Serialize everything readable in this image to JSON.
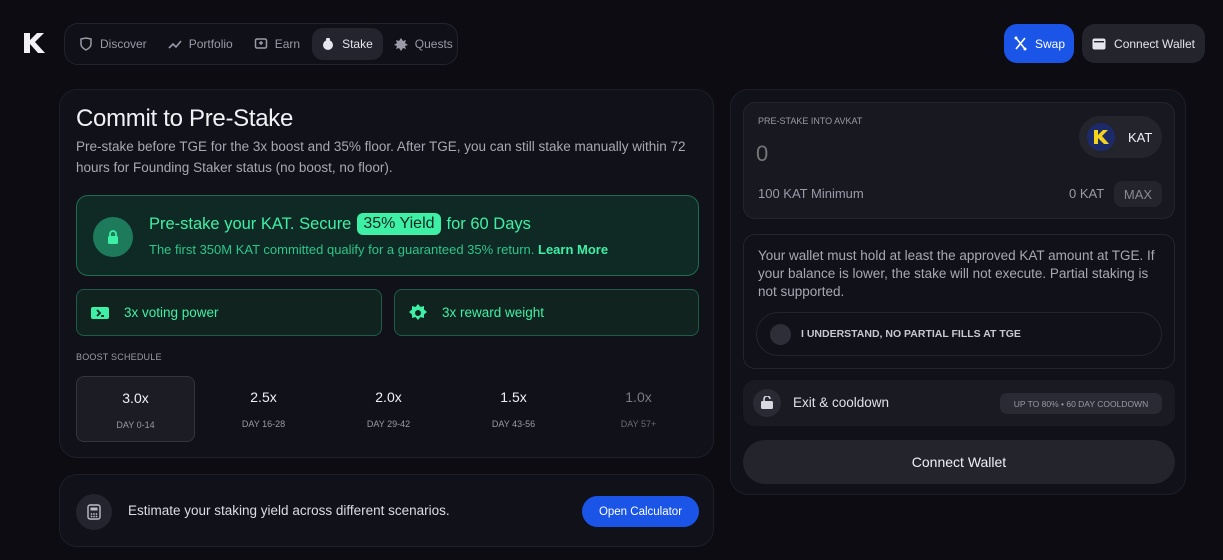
{
  "header": {
    "nav": [
      {
        "label": "Discover",
        "icon": "shield-icon"
      },
      {
        "label": "Portfolio",
        "icon": "trend-icon"
      },
      {
        "label": "Earn",
        "icon": "earn-icon"
      },
      {
        "label": "Stake",
        "icon": "stake-icon",
        "active": true
      },
      {
        "label": "Quests",
        "icon": "quests-icon"
      }
    ],
    "swap_label": "Swap",
    "connect_label": "Connect Wallet"
  },
  "main": {
    "title": "Commit to Pre-Stake",
    "description": "Pre-stake before TGE for the 3x boost and 35% floor. After TGE, you can still stake manually within 72 hours for Founding Staker status (no boost, no floor).",
    "promo": {
      "headline_pre": "Pre-stake your KAT. Secure",
      "headline_pill": "35% Yield",
      "headline_post": "for 60 Days",
      "subtext": "The first 350M KAT committed qualify for a guaranteed 35% return.",
      "link": "Learn More"
    },
    "perks": [
      "3x voting power",
      "3x reward weight"
    ],
    "boost_label": "BOOST SCHEDULE",
    "boost_schedule": [
      {
        "mult": "3.0x",
        "days": "DAY 0-14"
      },
      {
        "mult": "2.5x",
        "days": "DAY 16-28"
      },
      {
        "mult": "2.0x",
        "days": "DAY 29-42"
      },
      {
        "mult": "1.5x",
        "days": "DAY 43-56"
      },
      {
        "mult": "1.0x",
        "days": "DAY 57+"
      }
    ]
  },
  "calculator": {
    "text": "Estimate your staking yield across different scenarios.",
    "button": "Open Calculator"
  },
  "stake_panel": {
    "input_label": "PRE-STAKE INTO AVKAT",
    "amount_placeholder": "0",
    "token": "KAT",
    "minimum": "100 KAT Minimum",
    "balance": "0 KAT",
    "max_label": "MAX",
    "warning": "Your wallet must hold at least the approved KAT amount at TGE. If your balance is lower, the stake will not execute. Partial staking is not supported.",
    "acknowledge": "I UNDERSTAND, NO PARTIAL FILLS AT TGE",
    "exit_label": "Exit & cooldown",
    "exit_pill": "UP TO 80% • 60 DAY COOLDOWN",
    "connect_label": "Connect Wallet"
  },
  "colors": {
    "accent_blue": "#1a55e8",
    "accent_green": "#3ef0a6",
    "background": "#0c0c12"
  }
}
